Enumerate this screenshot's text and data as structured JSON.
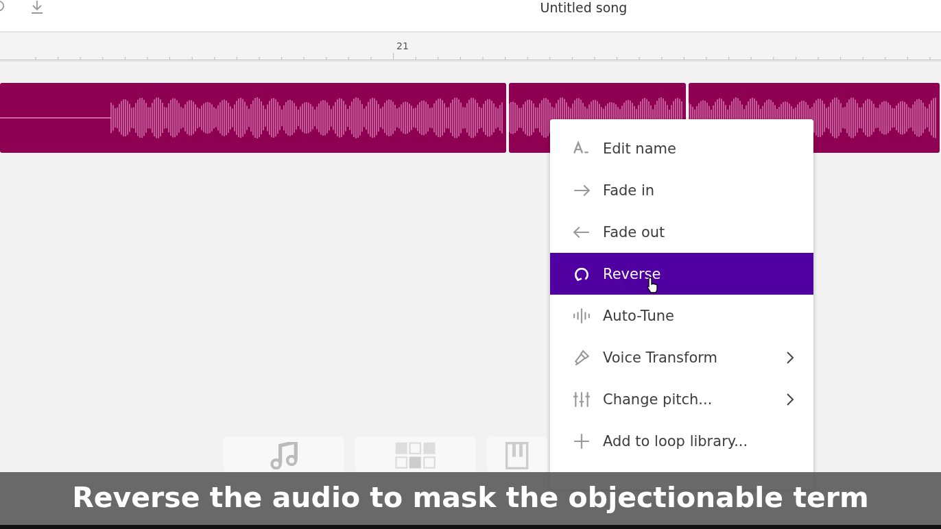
{
  "header": {
    "title": "Untitled song"
  },
  "ruler": {
    "label": "21"
  },
  "context_menu": {
    "items": [
      {
        "kind": "rename",
        "label": "Edit name",
        "selected": false,
        "submenu": false
      },
      {
        "kind": "fade-in",
        "label": "Fade in",
        "selected": false,
        "submenu": false
      },
      {
        "kind": "fade-out",
        "label": "Fade out",
        "selected": false,
        "submenu": false
      },
      {
        "kind": "reverse",
        "label": "Reverse",
        "selected": true,
        "submenu": false
      },
      {
        "kind": "autotune",
        "label": "Auto-Tune",
        "selected": false,
        "submenu": false
      },
      {
        "kind": "voice",
        "label": "Voice Transform",
        "selected": false,
        "submenu": true
      },
      {
        "kind": "pitch",
        "label": "Change pitch...",
        "selected": false,
        "submenu": true
      },
      {
        "kind": "add",
        "label": "Add to loop library...",
        "selected": false,
        "submenu": false
      }
    ]
  },
  "caption": "Reverse the audio to mask the objectionable term"
}
